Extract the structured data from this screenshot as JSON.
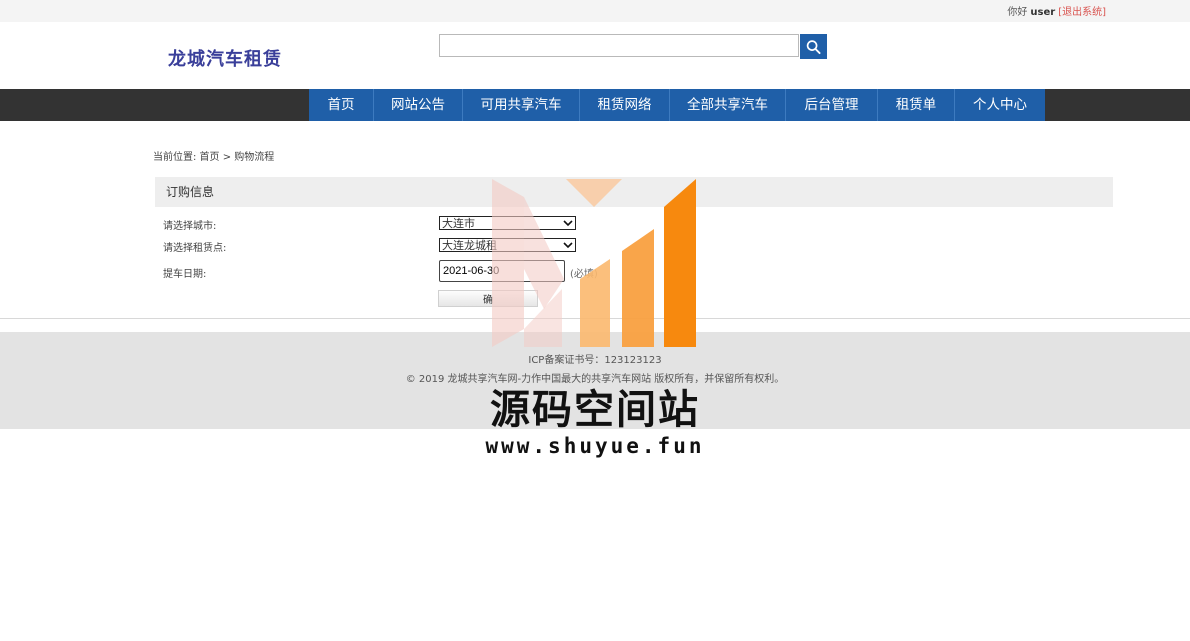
{
  "topbar": {
    "greeting": "你好",
    "username": "user",
    "logout": "[退出系统]"
  },
  "header": {
    "logo": "龙城汽车租赁",
    "search_placeholder": ""
  },
  "nav": {
    "items": [
      {
        "label": "首页"
      },
      {
        "label": "网站公告"
      },
      {
        "label": "可用共享汽车"
      },
      {
        "label": "租赁网络"
      },
      {
        "label": "全部共享汽车"
      },
      {
        "label": "后台管理"
      },
      {
        "label": "租赁单"
      },
      {
        "label": "个人中心"
      }
    ]
  },
  "breadcrumb": "当前位置: 首页 > 购物流程",
  "order": {
    "title": "订购信息",
    "city_label": "请选择城市:",
    "city_value": "大连市",
    "point_label": "请选择租赁点:",
    "point_value": "大连龙城租",
    "date_label": "提车日期:",
    "date_value": "2021-06-30",
    "date_hint": "(必填)",
    "confirm": "确"
  },
  "footer": {
    "icp": "ICP备案证书号：123123123",
    "copyright": "© 2019 龙城共享汽车网-力作中国最大的共享汽车网站 版权所有，并保留所有权利。"
  },
  "watermark": {
    "title": "源码空间站",
    "url": "www.shuyue.fun"
  },
  "colors": {
    "nav_blue": "#1f5fa8",
    "nav_dark": "#333333",
    "logo": "#3a3f9a",
    "logout": "#d9534f"
  },
  "icons": {
    "search": "search-icon",
    "dropdown": "chevron-down-icon"
  }
}
